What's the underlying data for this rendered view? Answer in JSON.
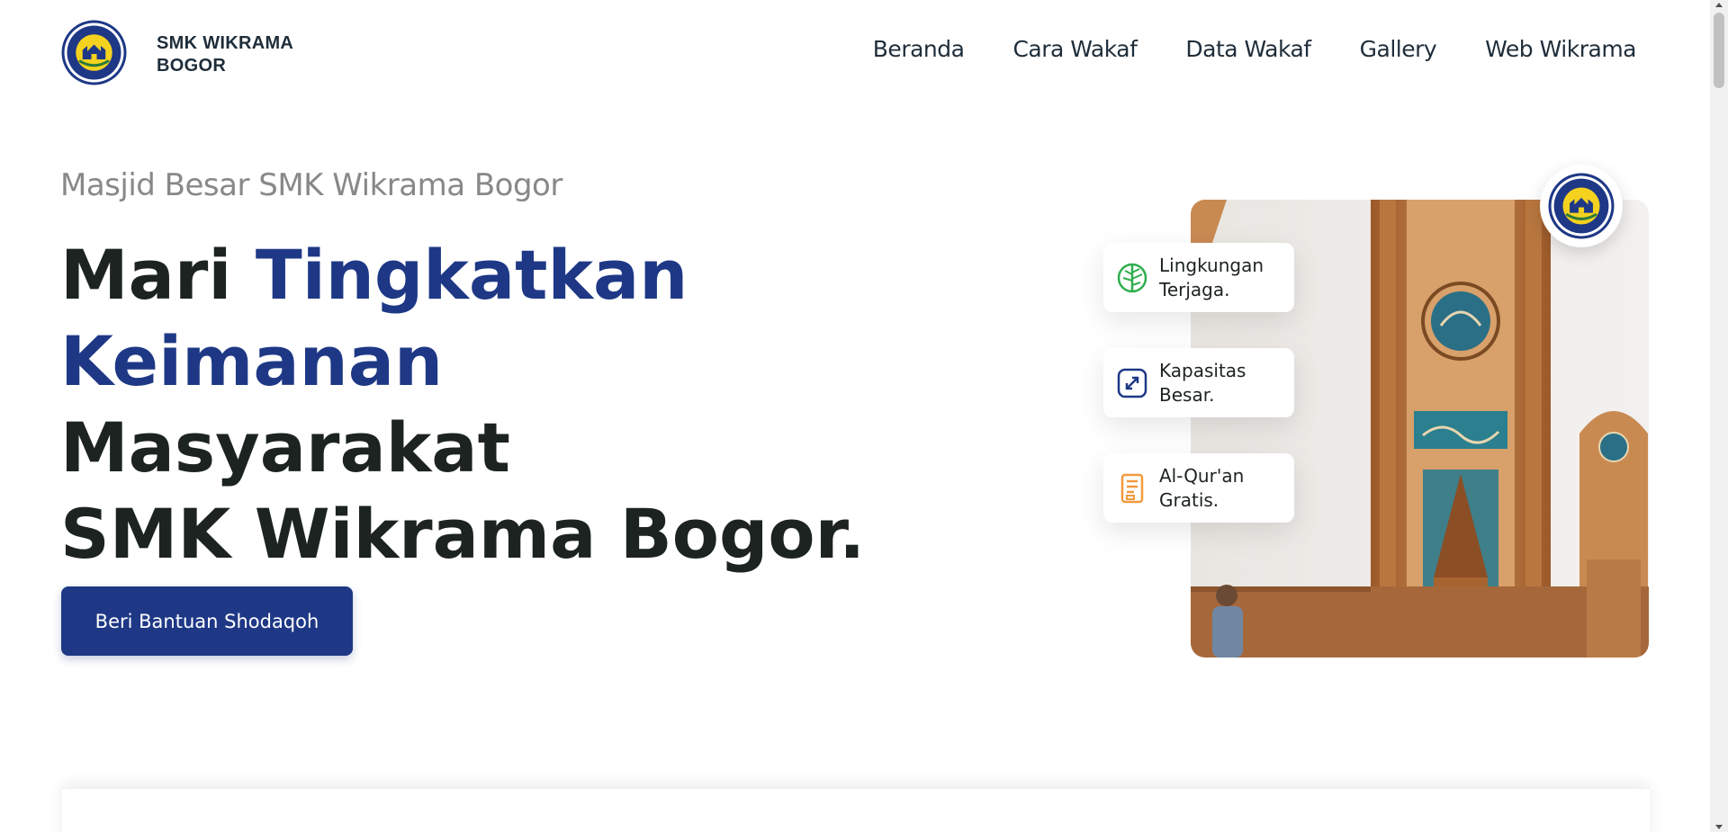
{
  "brand": {
    "name_line1": "SMK WIKRAMA",
    "name_line2": "BOGOR",
    "logo_icon": "smk-wikrama-emblem-icon",
    "logo_text_top": "SMK WIKRAMA",
    "logo_text_bottom": "KOTA BOGOR"
  },
  "nav": {
    "items": [
      {
        "label": "Beranda"
      },
      {
        "label": "Cara Wakaf"
      },
      {
        "label": "Data Wakaf"
      },
      {
        "label": "Gallery"
      },
      {
        "label": "Web Wikrama"
      }
    ]
  },
  "hero": {
    "eyebrow": "Masjid Besar SMK Wikrama Bogor",
    "headline": {
      "part1": "Mari ",
      "highlight1": "Tingkatkan",
      "highlight2": "Keimanan",
      "part2": " Masyarakat",
      "part3": "SMK Wikrama Bogor."
    },
    "cta_label": "Beri Bantuan Shodaqoh"
  },
  "features": [
    {
      "line1": "Lingkungan",
      "line2": "Terjaga.",
      "icon": "leaf-icon",
      "color": "#2fae4e"
    },
    {
      "line1": "Kapasitas",
      "line2": "Besar.",
      "icon": "expand-icon",
      "color": "#1e3886"
    },
    {
      "line1": "Al-Qur'an",
      "line2": "Gratis.",
      "icon": "book-icon",
      "color": "#f39a3d"
    }
  ],
  "image": {
    "description_icon": "mosque-interior-photo"
  },
  "colors": {
    "accent": "#1e3886",
    "heading": "#1c2321",
    "eyebrow": "#888888"
  }
}
